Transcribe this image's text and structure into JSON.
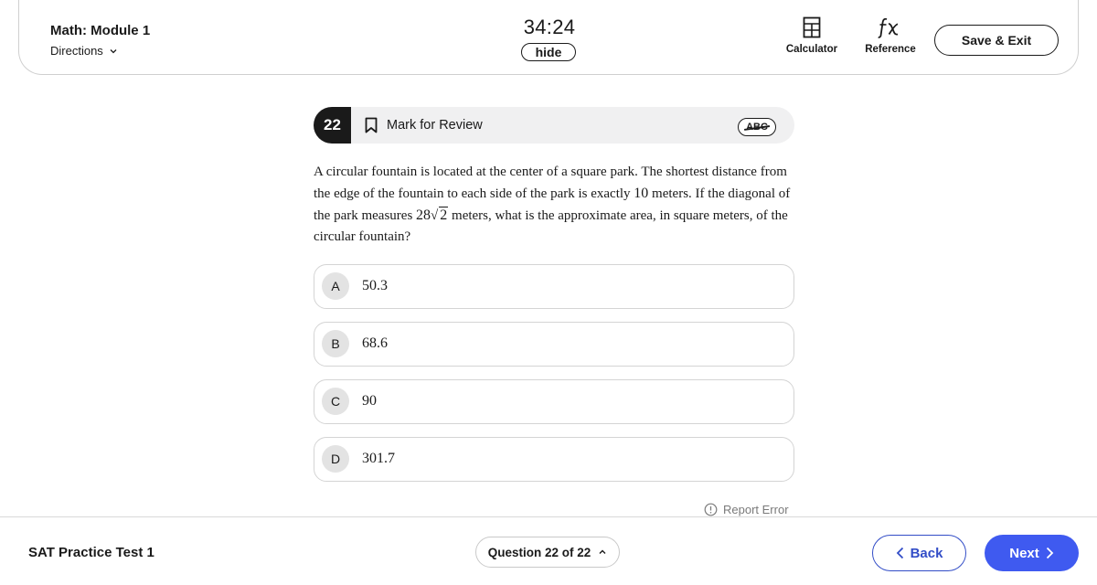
{
  "header": {
    "module_title": "Math: Module 1",
    "directions_label": "Directions",
    "timer": "34:24",
    "hide_label": "hide",
    "tools": [
      {
        "label": "Calculator",
        "icon": "calculator-icon"
      },
      {
        "label": "Reference",
        "icon": "fx-formula-icon"
      }
    ],
    "save_exit_label": "Save & Exit"
  },
  "question": {
    "number": "22",
    "mark_for_review_label": "Mark for Review",
    "answer_eliminator_label": "ABC",
    "text_parts": {
      "p1": "A circular fountain is located at the center of a square park. The shortest distance from the edge of the fountain to each side of the park is exactly ",
      "n1": "10",
      "p2": " meters. If the diagonal of the park measures ",
      "coef": "28",
      "radicand": "2",
      "p3": " meters, what is the approximate area, in square meters, of the circular fountain?"
    },
    "choices": [
      {
        "letter": "A",
        "value": "50.3"
      },
      {
        "letter": "B",
        "value": "68.6"
      },
      {
        "letter": "C",
        "value": "90"
      },
      {
        "letter": "D",
        "value": "301.7"
      }
    ],
    "report_error_label": "Report Error"
  },
  "footer": {
    "test_name": "SAT Practice Test 1",
    "question_nav_label": "Question 22 of 22",
    "back_label": "Back",
    "next_label": "Next"
  },
  "colors": {
    "accent": "#3f5af0",
    "back_border": "#324dc7",
    "dark": "#1a1a1a",
    "bar_bg": "#f0f0f1"
  }
}
